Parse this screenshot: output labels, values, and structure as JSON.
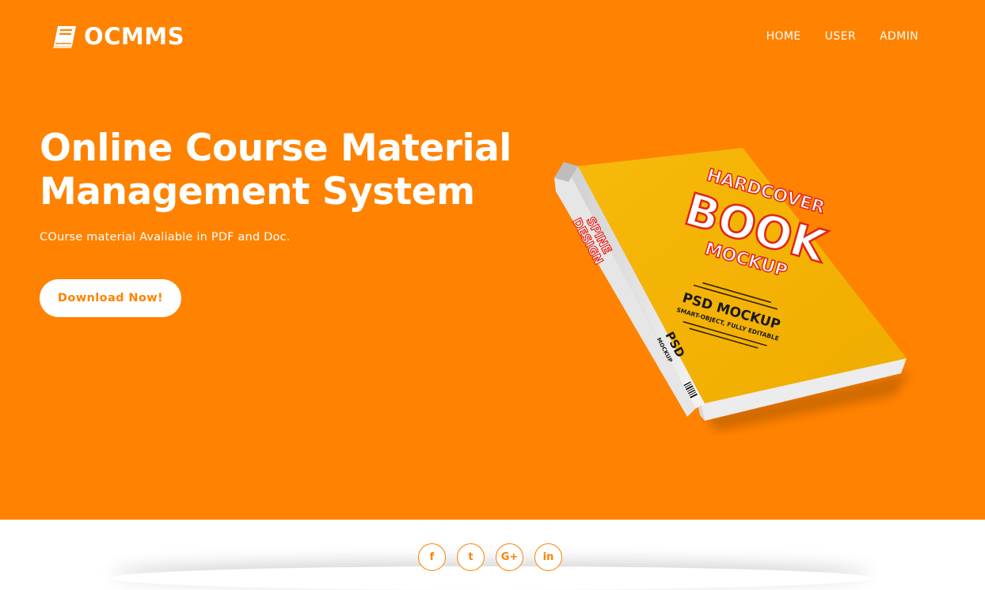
{
  "brand": {
    "name": "OCMMS",
    "icon": "book-icon"
  },
  "nav": {
    "items": [
      {
        "label": "HOME"
      },
      {
        "label": "USER"
      },
      {
        "label": "ADMIN"
      }
    ]
  },
  "hero": {
    "title_line1": "Online Course Material",
    "title_line2": "Management System",
    "subtitle": "COurse material Avaliable in PDF and Doc.",
    "cta_label": "Download Now!"
  },
  "book_cover": {
    "line1": "HARDCOVER",
    "line2": "BOOK",
    "line3": "MOCKUP",
    "line4": "PSD MOCKUP",
    "line5": "SMART-OBJECT, FULLY EDITABLE",
    "spine_top": "SPINE",
    "spine_mid": "DESIGN",
    "spine_psd": "PSD",
    "spine_mockup": "MOCKUP"
  },
  "social": {
    "items": [
      {
        "glyph": "f",
        "icon": "facebook-icon"
      },
      {
        "glyph": "t",
        "icon": "twitter-icon"
      },
      {
        "glyph": "G+",
        "icon": "google-plus-icon"
      },
      {
        "glyph": "in",
        "icon": "linkedin-icon"
      }
    ]
  },
  "colors": {
    "accent": "#ff8200",
    "book_cover": "#f4b800",
    "book_red": "#e2231a"
  }
}
